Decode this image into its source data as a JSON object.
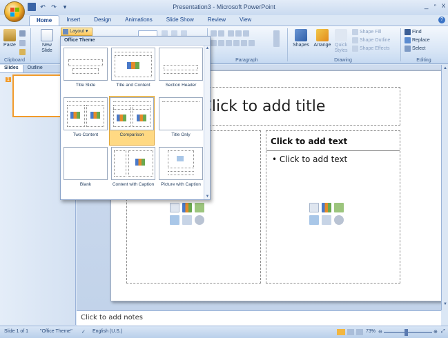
{
  "window": {
    "title": "Presentation3 - Microsoft PowerPoint",
    "controls": [
      "_",
      "▫",
      "x"
    ]
  },
  "quick_access": [
    "💾",
    "↶",
    "↷",
    "▾"
  ],
  "tabs": [
    {
      "label": "Home"
    },
    {
      "label": "Insert"
    },
    {
      "label": "Design"
    },
    {
      "label": "Animations"
    },
    {
      "label": "Slide Show"
    },
    {
      "label": "Review"
    },
    {
      "label": "View"
    }
  ],
  "ribbon": {
    "clipboard": {
      "paste": "Paste",
      "label": "Clipboard"
    },
    "slides": {
      "new_slide": "New Slide",
      "layout": "Layout"
    },
    "paragraph": {
      "label": "Paragraph"
    },
    "drawing": {
      "shapes": "Shapes",
      "arrange": "Arrange",
      "quick_styles": "Quick Styles",
      "shape_fill": "Shape Fill",
      "shape_outline": "Shape Outline",
      "shape_effects": "Shape Effects",
      "label": "Drawing"
    },
    "editing": {
      "find": "Find",
      "replace": "Replace",
      "select": "Select",
      "label": "Editing"
    }
  },
  "layout_gallery": {
    "header": "Office Theme",
    "items": [
      {
        "label": "Title Slide"
      },
      {
        "label": "Title and Content"
      },
      {
        "label": "Section Header"
      },
      {
        "label": "Two Content"
      },
      {
        "label": "Comparison",
        "selected": true
      },
      {
        "label": "Title Only"
      },
      {
        "label": "Blank"
      },
      {
        "label": "Content with Caption"
      },
      {
        "label": "Picture with Caption"
      }
    ]
  },
  "left_pane": {
    "tabs": [
      "Slides",
      "Outline"
    ],
    "slide_number": "1"
  },
  "slide": {
    "title_placeholder": "Click to add title",
    "right_header": "Click to add text",
    "right_bullet": "Click to add text"
  },
  "notes": {
    "placeholder": "Click to add notes"
  },
  "status_bar": {
    "slide_info": "Slide 1 of 1",
    "theme": "\"Office Theme\"",
    "language": "English (U.S.)",
    "zoom": "73%"
  },
  "colors": {
    "accent": "#f29b2a",
    "ribbon_bg": "#d6e4f5",
    "selected_item": "#ffd983"
  }
}
